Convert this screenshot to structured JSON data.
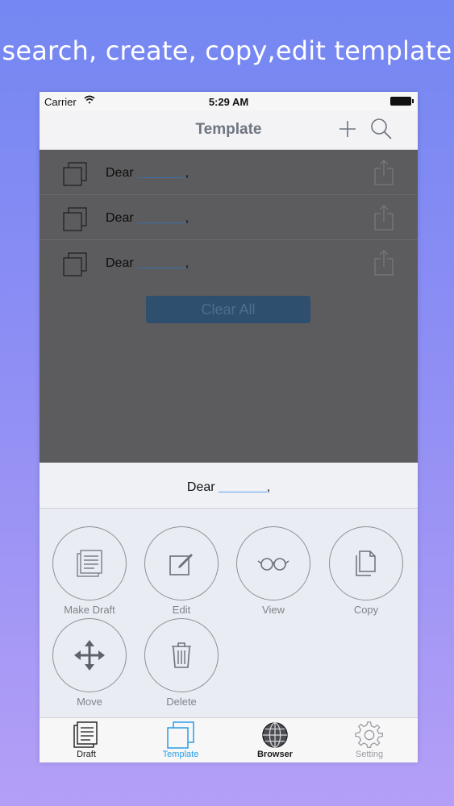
{
  "headline": "search, create, copy,edit template",
  "status": {
    "carrier": "Carrier",
    "time": "5:29 AM"
  },
  "nav": {
    "title": "Template"
  },
  "templates": [
    {
      "text": "Dear",
      "suffix": ","
    },
    {
      "text": "Dear",
      "suffix": ","
    },
    {
      "text": "Dear",
      "suffix": ","
    }
  ],
  "clear_all_label": "Clear All",
  "sheet": {
    "title_text": "Dear",
    "title_suffix": ",",
    "actions": [
      {
        "label": "Make Draft",
        "icon": "document-icon"
      },
      {
        "label": "Edit",
        "icon": "pencil-square-icon"
      },
      {
        "label": "View",
        "icon": "glasses-icon"
      },
      {
        "label": "Copy",
        "icon": "copy-icon"
      },
      {
        "label": "Move",
        "icon": "move-arrows-icon"
      },
      {
        "label": "Delete",
        "icon": "trash-icon"
      }
    ]
  },
  "tabs": [
    {
      "label": "Draft",
      "icon": "draft-icon",
      "active": false
    },
    {
      "label": "Template",
      "icon": "template-icon",
      "active": true
    },
    {
      "label": "Browser",
      "icon": "globe-icon",
      "active": false
    },
    {
      "label": "Setting",
      "icon": "gear-icon",
      "active": false
    }
  ],
  "colors": {
    "active_tab": "#2a9ee6",
    "inactive_tab": "#1c1c1e",
    "disabled_tab": "#9a9ca2",
    "nav_title": "#6e7480",
    "blank_line_sheet": "#62a6f2"
  }
}
